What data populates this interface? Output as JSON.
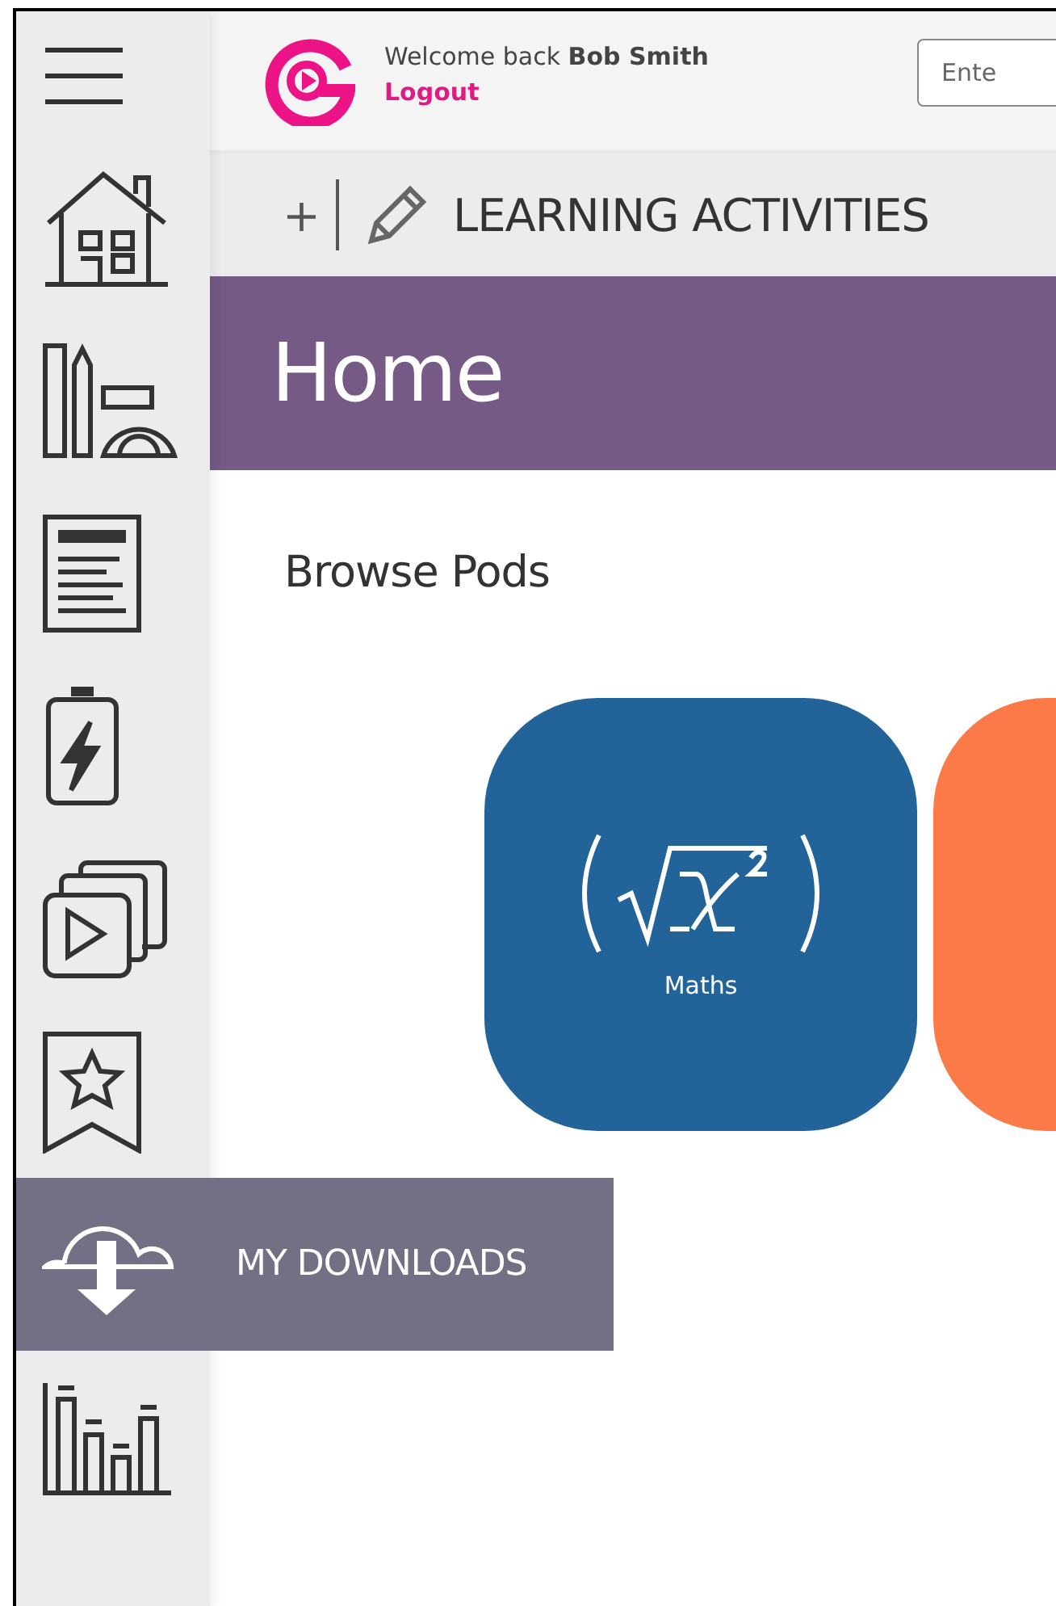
{
  "sidebar": {
    "items": [
      {
        "kind": "menu",
        "highlighted": false
      },
      {
        "kind": "home",
        "highlighted": false
      },
      {
        "kind": "tools",
        "highlighted": false
      },
      {
        "kind": "document",
        "highlighted": false
      },
      {
        "kind": "battery",
        "highlighted": false
      },
      {
        "kind": "videos",
        "highlighted": false
      },
      {
        "kind": "bookmark",
        "highlighted": false
      },
      {
        "kind": "downloads",
        "highlighted": true,
        "label": "MY DOWNLOADS"
      },
      {
        "kind": "chart",
        "highlighted": false
      }
    ]
  },
  "header": {
    "welcome": "Welcome back **Bob Smith**",
    "logout": "Logout",
    "search": {
      "placeholder": "Ente"
    }
  },
  "toolbar": {
    "add": "+",
    "title": "LEARNING ACTIVITIES"
  },
  "banner": {
    "title": "Home"
  },
  "section": {
    "title": "Browse Pods"
  },
  "pods": [
    {
      "label": "Maths",
      "color": "#226399"
    },
    {
      "color": "#fb7a48"
    }
  ]
}
